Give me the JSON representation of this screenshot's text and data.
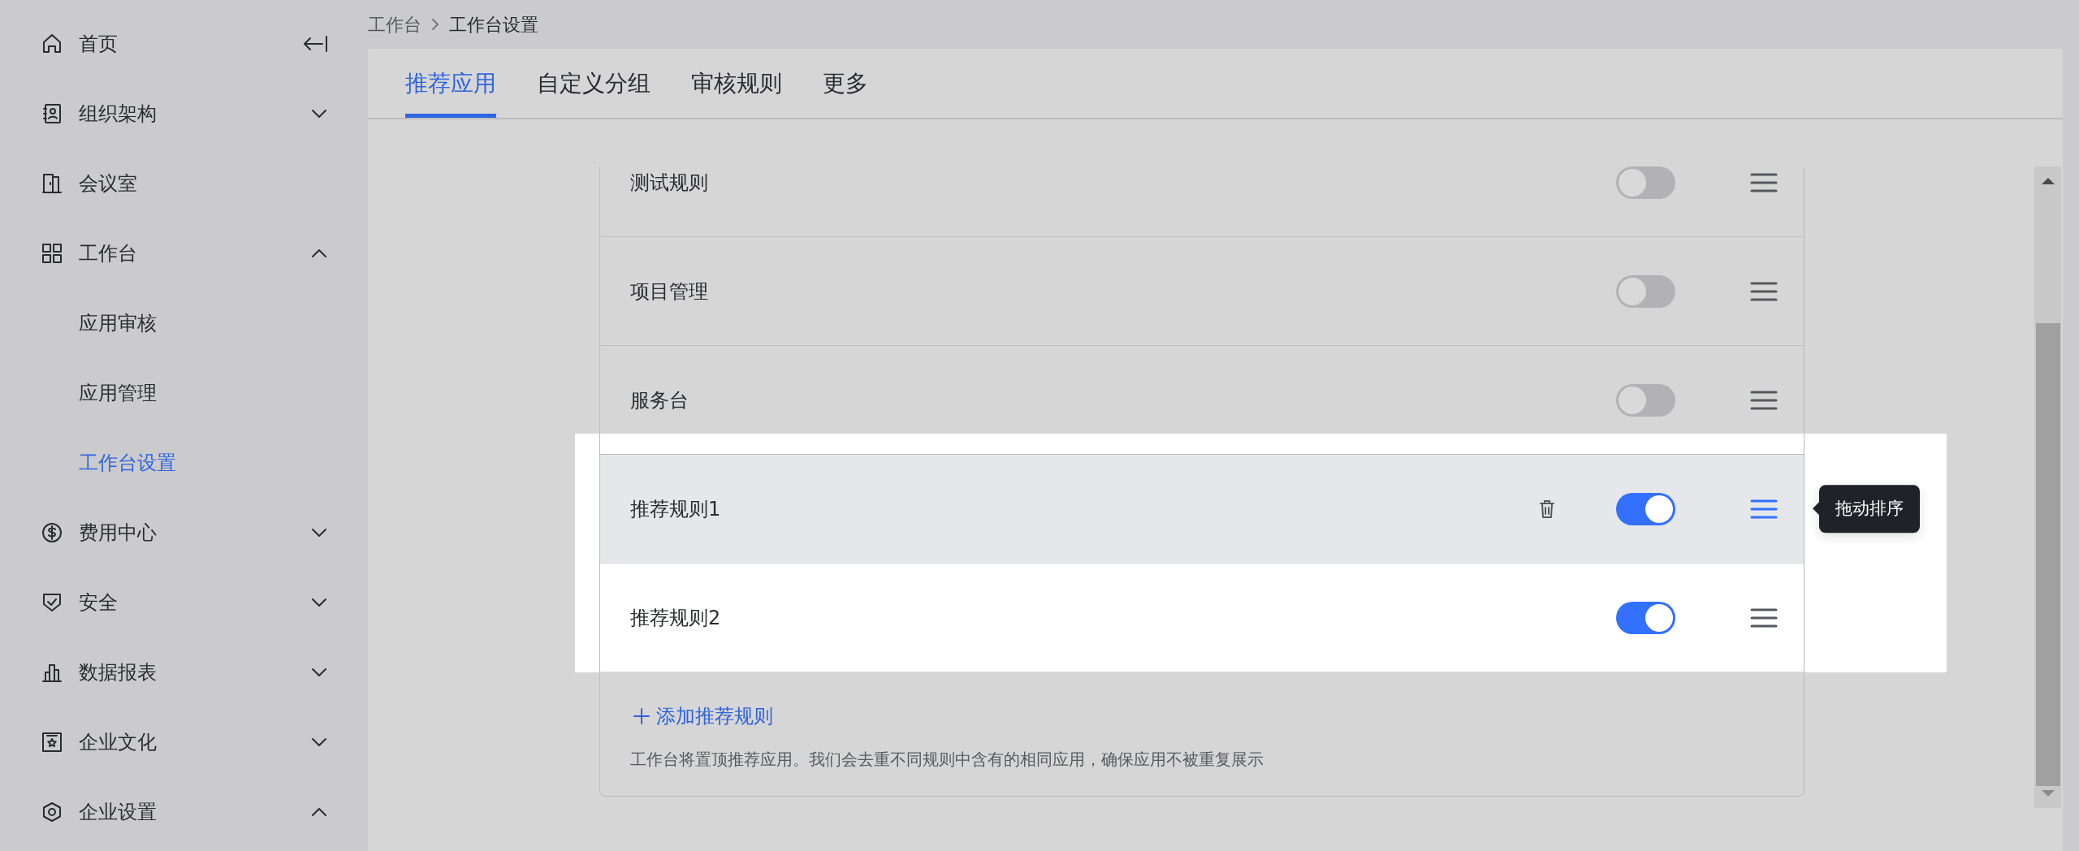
{
  "sidebar": {
    "items": [
      {
        "label": "首页",
        "selected": false
      },
      {
        "label": "组织架构",
        "selected": false,
        "expanded": false
      },
      {
        "label": "会议室",
        "selected": false
      },
      {
        "label": "工作台",
        "selected": false,
        "expanded": true,
        "children": [
          {
            "label": "应用审核",
            "selected": false
          },
          {
            "label": "应用管理",
            "selected": false
          },
          {
            "label": "工作台设置",
            "selected": true
          }
        ]
      },
      {
        "label": "费用中心",
        "selected": false,
        "expanded": false
      },
      {
        "label": "安全",
        "selected": false,
        "expanded": false
      },
      {
        "label": "数据报表",
        "selected": false,
        "expanded": false
      },
      {
        "label": "企业文化",
        "selected": false,
        "expanded": false
      },
      {
        "label": "企业设置",
        "selected": false,
        "expanded": true
      }
    ]
  },
  "breadcrumb": [
    "工作台",
    "工作台设置"
  ],
  "tabs": [
    {
      "label": "推荐应用",
      "selected": true
    },
    {
      "label": "自定义分组",
      "selected": false
    },
    {
      "label": "审核规则",
      "selected": false
    },
    {
      "label": "更多",
      "selected": false
    }
  ],
  "rules": [
    {
      "name": "测试规则",
      "on": false,
      "hovered": false,
      "highlighted": false
    },
    {
      "name": "项目管理",
      "on": false,
      "hovered": false,
      "highlighted": false
    },
    {
      "name": "服务台",
      "on": false,
      "hovered": false,
      "highlighted": false
    },
    {
      "name": "推荐规则1",
      "on": true,
      "hovered": true,
      "highlighted": true
    },
    {
      "name": "推荐规则2",
      "on": true,
      "hovered": false,
      "highlighted": true
    }
  ],
  "add_button": {
    "label": "添加推荐规则"
  },
  "hint": "工作台将置顶推荐应用。我们会去重不同规则中含有的相同应用，确保应用不被重复展示",
  "tooltip": {
    "text": "拖动排序"
  }
}
